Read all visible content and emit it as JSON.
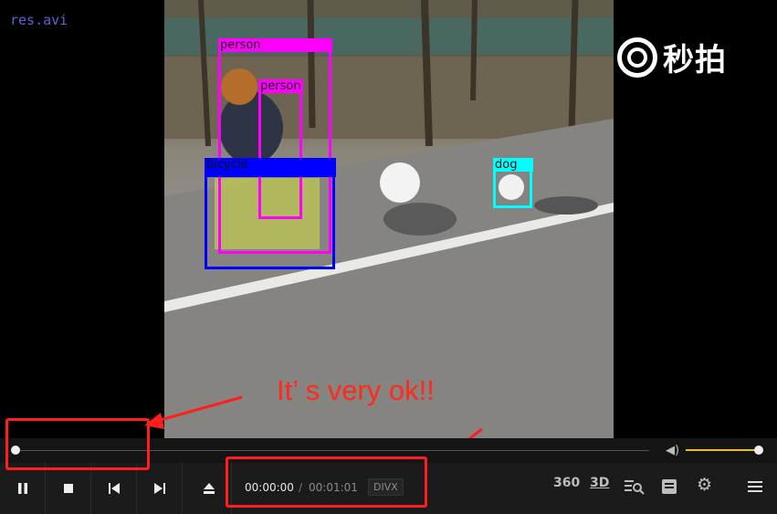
{
  "window": {
    "filename": "res.avi"
  },
  "video": {
    "detections": [
      {
        "label": "person",
        "color": "#ff00ff"
      },
      {
        "label": "person",
        "color": "#ff00ff"
      },
      {
        "label": "bicycle",
        "color": "#0000ff"
      },
      {
        "label": "dog",
        "color": "#00ffff"
      }
    ],
    "watermark": "秒拍"
  },
  "annotation": {
    "text": "It’ s very ok!!",
    "color": "#ff2a1a"
  },
  "controls": {
    "current_time": "00:00:00",
    "separator": "/",
    "duration": "00:01:01",
    "codec": "DIVX",
    "icons": {
      "play_pause": "pause-icon",
      "stop": "stop-icon",
      "prev": "previous-icon",
      "next": "next-icon",
      "eject": "eject-icon",
      "view360": "360-icon",
      "view3d": "3d-icon",
      "search": "search-list-icon",
      "playlist": "playlist-icon",
      "settings": "gear-icon",
      "menu": "menu-icon",
      "volume": "volume-icon"
    },
    "label_360": "360",
    "label_3d": "3D",
    "volume_level": 1.0,
    "progress": 0.0
  },
  "colors": {
    "volume_accent": "#e8c21a",
    "annotation_box": "#ff1e1e"
  }
}
